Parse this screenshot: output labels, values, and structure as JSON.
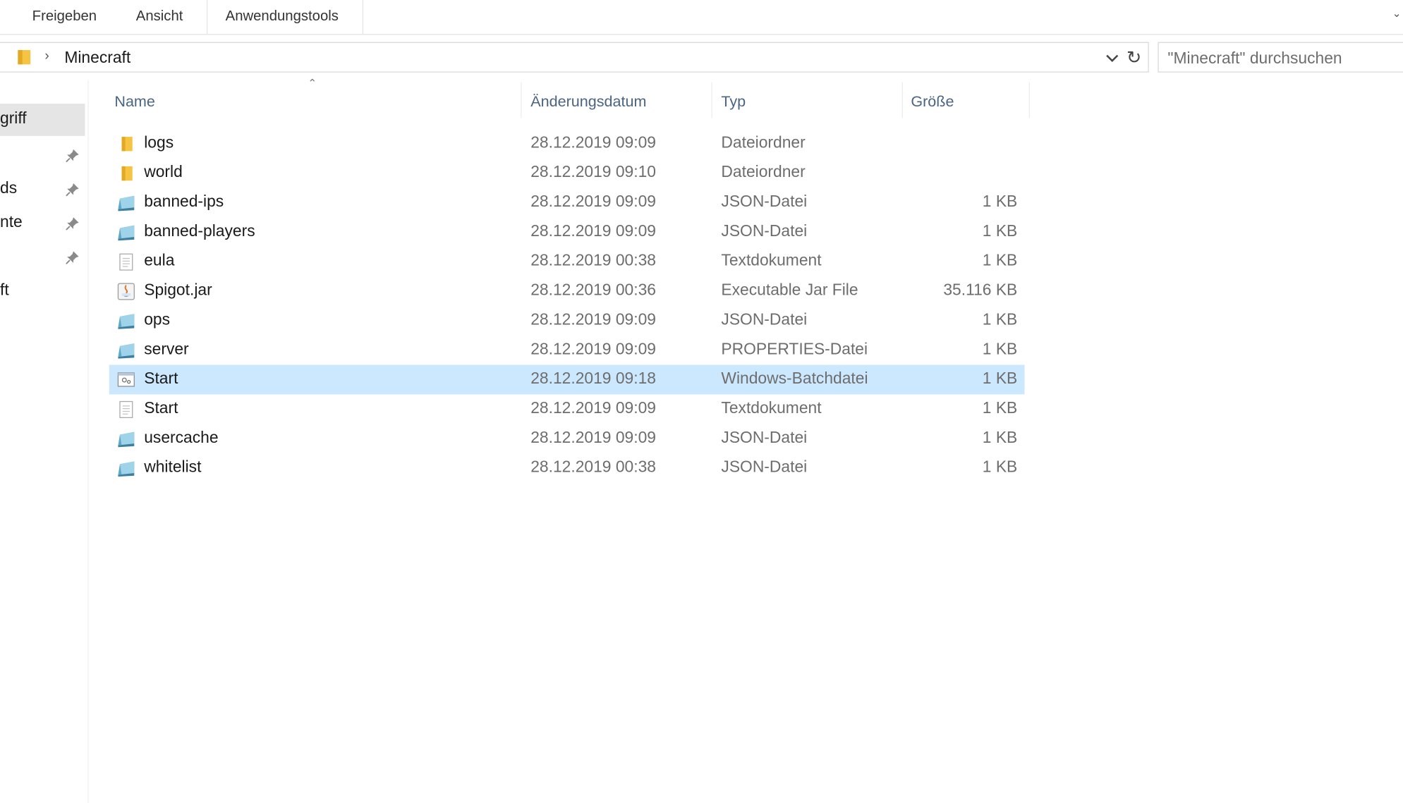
{
  "ribbon": {
    "tabs": [
      {
        "label": "Freigeben"
      },
      {
        "label": "Ansicht"
      },
      {
        "label": "Anwendungstools"
      }
    ]
  },
  "address": {
    "path": "Minecraft",
    "search_placeholder": "\"Minecraft\" durchsuchen"
  },
  "nav": {
    "items": [
      {
        "label": "griff",
        "selected": true,
        "pinned": false
      },
      {
        "label": "",
        "selected": false,
        "pinned": true
      },
      {
        "label": "ds",
        "selected": false,
        "pinned": true
      },
      {
        "label": "nte",
        "selected": false,
        "pinned": true
      },
      {
        "label": "",
        "selected": false,
        "pinned": true
      },
      {
        "label": "ft",
        "selected": false,
        "pinned": false
      }
    ]
  },
  "list": {
    "columns": {
      "name": "Name",
      "date": "Änderungsdatum",
      "type": "Typ",
      "size": "Größe"
    },
    "rows": [
      {
        "name": "logs",
        "date": "28.12.2019 09:09",
        "type": "Dateiordner",
        "size": "",
        "icon": "folder-icon"
      },
      {
        "name": "world",
        "date": "28.12.2019 09:10",
        "type": "Dateiordner",
        "size": "",
        "icon": "folder-icon"
      },
      {
        "name": "banned-ips",
        "date": "28.12.2019 09:09",
        "type": "JSON-Datei",
        "size": "1 KB",
        "icon": "json-file-icon"
      },
      {
        "name": "banned-players",
        "date": "28.12.2019 09:09",
        "type": "JSON-Datei",
        "size": "1 KB",
        "icon": "json-file-icon"
      },
      {
        "name": "eula",
        "date": "28.12.2019 00:38",
        "type": "Textdokument",
        "size": "1 KB",
        "icon": "text-file-icon"
      },
      {
        "name": "Spigot.jar",
        "date": "28.12.2019 00:36",
        "type": "Executable Jar File",
        "size": "35.116 KB",
        "icon": "java-jar-icon"
      },
      {
        "name": "ops",
        "date": "28.12.2019 09:09",
        "type": "JSON-Datei",
        "size": "1 KB",
        "icon": "json-file-icon"
      },
      {
        "name": "server",
        "date": "28.12.2019 09:09",
        "type": "PROPERTIES-Datei",
        "size": "1 KB",
        "icon": "json-file-icon"
      },
      {
        "name": "Start",
        "date": "28.12.2019 09:18",
        "type": "Windows-Batchdatei",
        "size": "1 KB",
        "icon": "batch-file-icon",
        "selected": true
      },
      {
        "name": "Start",
        "date": "28.12.2019 09:09",
        "type": "Textdokument",
        "size": "1 KB",
        "icon": "text-file-icon"
      },
      {
        "name": "usercache",
        "date": "28.12.2019 09:09",
        "type": "JSON-Datei",
        "size": "1 KB",
        "icon": "json-file-icon"
      },
      {
        "name": "whitelist",
        "date": "28.12.2019 00:38",
        "type": "JSON-Datei",
        "size": "1 KB",
        "icon": "json-file-icon"
      }
    ]
  },
  "colors": {
    "selection": "#cce8ff",
    "header_text": "#4a6584",
    "folder": "#f5c443"
  }
}
